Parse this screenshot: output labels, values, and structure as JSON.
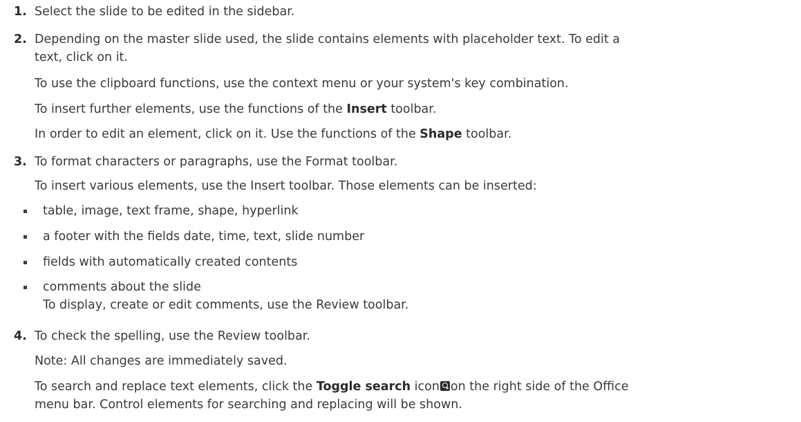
{
  "steps": [
    {
      "number": "1.",
      "lines": [
        "Select the slide to be edited in the sidebar."
      ]
    },
    {
      "number": "2.",
      "intro_line1": "Depending on the master slide used, the slide contains elements with placeholder text. To edit a",
      "intro_line2": "text, click on it.",
      "clipboard": "To use the clipboard functions, use the context menu or your system's key combination.",
      "insert_pre": "To insert further elements, use the functions of the ",
      "insert_bold": "Insert",
      "insert_post": " toolbar.",
      "edit_pre": "In order to edit an element, click on it. Use the functions of the ",
      "edit_bold": "Shape",
      "edit_post": " toolbar."
    },
    {
      "number": "3.",
      "format": "To format characters or paragraphs, use the Format toolbar.",
      "insert_various": "To insert various elements, use the Insert toolbar. Those elements can be inserted:",
      "bullets": [
        "table, image, text frame, shape, hyperlink",
        "a footer with the fields date, time, text, slide number",
        "fields with automatically created contents",
        "comments about the slide"
      ],
      "comments_sub": "To display, create or edit comments, use the Review toolbar."
    },
    {
      "number": "4.",
      "spelling": "To check the spelling, use the Review toolbar.",
      "note": "Note: All changes are immediately saved.",
      "search_pre": "To search and replace text elements, click the ",
      "search_bold": "Toggle search",
      "search_mid": " icon",
      "search_post": "on the right side of the Office",
      "search_line2": "menu bar. Control elements for searching and replacing will be shown.",
      "icon": "search-icon"
    }
  ]
}
